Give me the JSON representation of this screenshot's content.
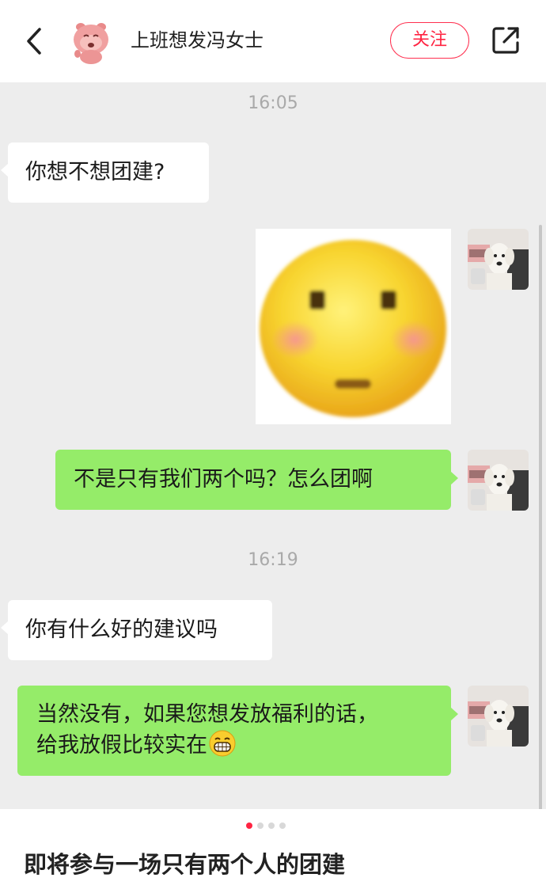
{
  "header": {
    "author_name": "上班想发冯女士",
    "follow_label": "关注",
    "back_icon": "chevron-left-icon",
    "share_icon": "share-out-icon"
  },
  "chat": {
    "timestamps": [
      "16:05",
      "16:19"
    ],
    "messages": [
      {
        "side": "left",
        "text": "你想不想团建?"
      },
      {
        "side": "right",
        "type": "sticker",
        "sticker": "blushing-face-sticker"
      },
      {
        "side": "right",
        "text": "不是只有我们两个吗？怎么团啊"
      },
      {
        "side": "left",
        "text": "你有什么好的建议吗"
      },
      {
        "side": "right",
        "lines": [
          "当然没有，如果您想发放福利的话，",
          "给我放假比较实在"
        ],
        "emoji": "grin-emoji"
      }
    ]
  },
  "footer": {
    "caption": "即将参与一场只有两个人的团建",
    "page_dots": 4,
    "active_dot": 1
  },
  "colors": {
    "accent": "#ff2442",
    "chat_bg": "#ededed",
    "bubble_green": "#95ec69",
    "bubble_white": "#ffffff"
  }
}
